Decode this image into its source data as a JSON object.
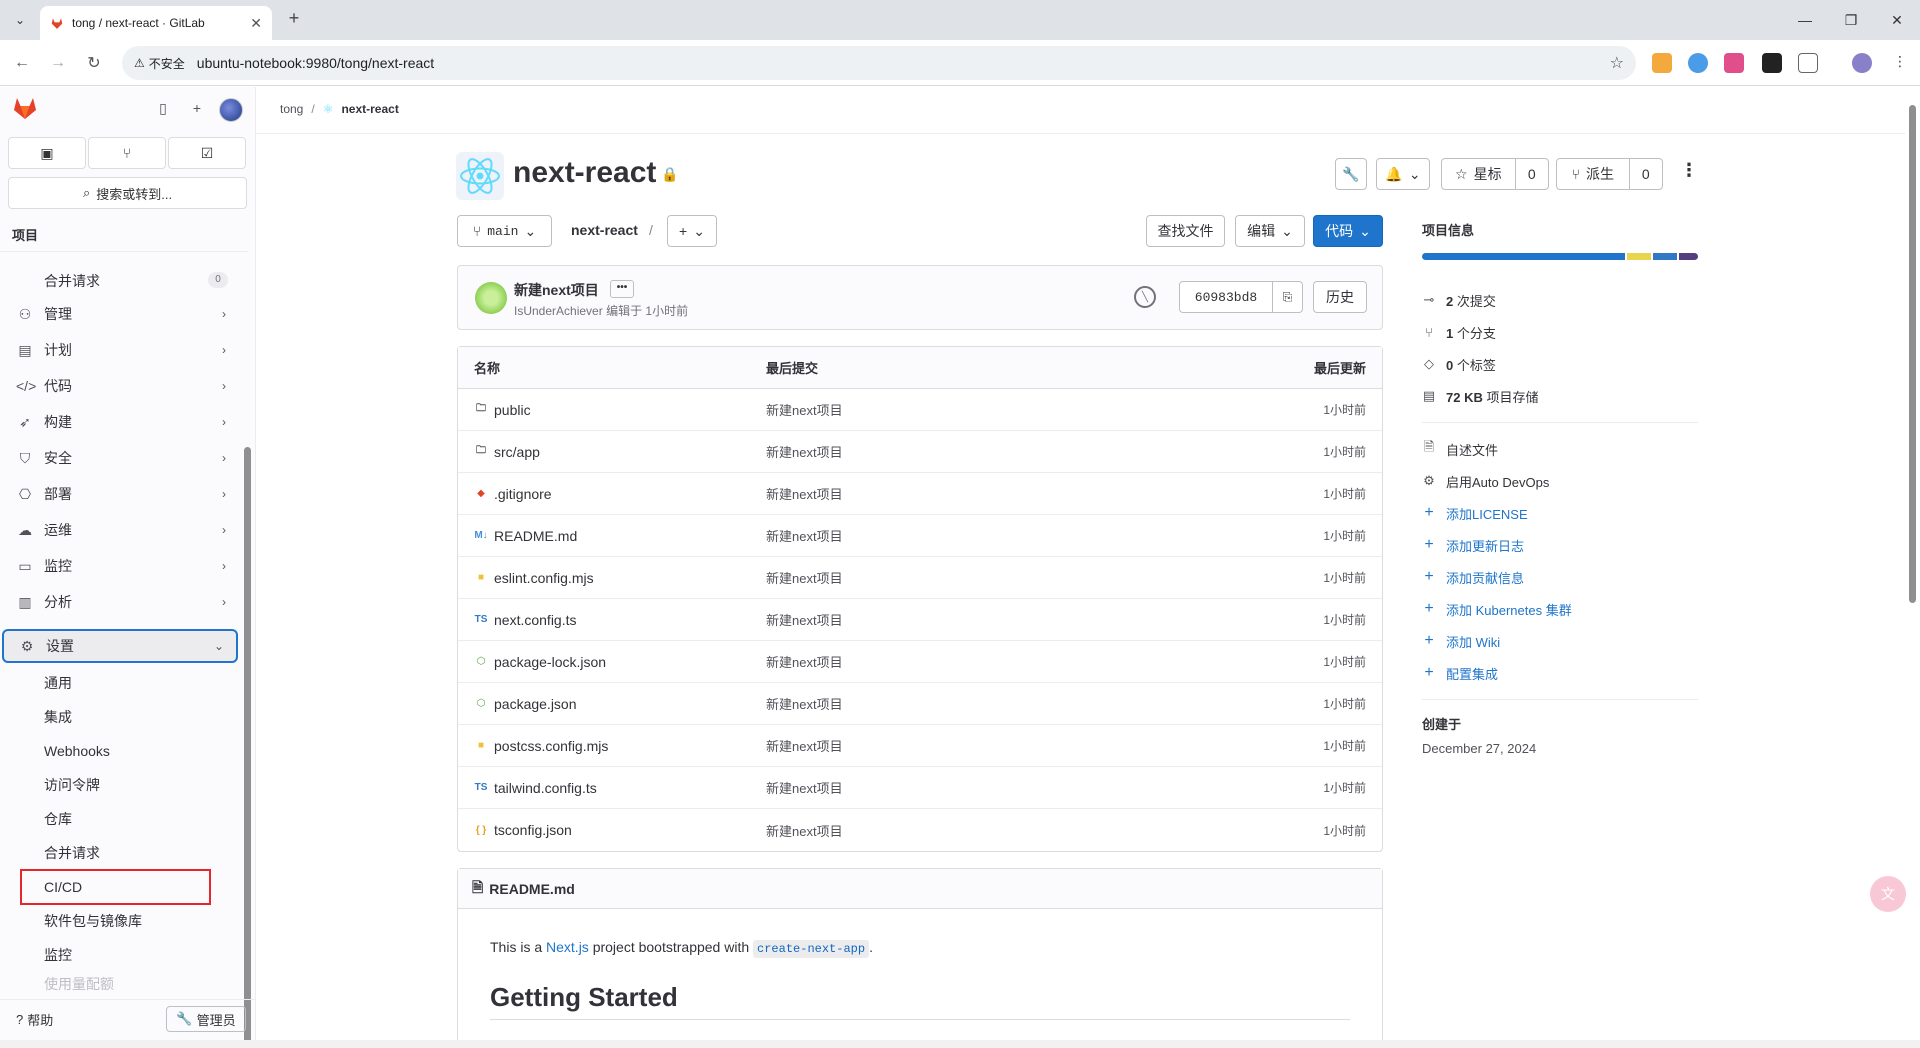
{
  "browser": {
    "tab_title": "tong / next-react · GitLab",
    "new_tab": "+",
    "insecure_label": "不安全",
    "url": "ubuntu-notebook:9980/tong/next-react"
  },
  "sidebar": {
    "search_label": "搜索或转到...",
    "section_label": "项目",
    "merge_requests": "合并请求",
    "merge_requests_count": "0",
    "nav": [
      {
        "label": "管理",
        "icon": "users-icon"
      },
      {
        "label": "计划",
        "icon": "calendar-icon"
      },
      {
        "label": "代码",
        "icon": "code-icon"
      },
      {
        "label": "构建",
        "icon": "rocket-icon"
      },
      {
        "label": "安全",
        "icon": "shield-icon"
      },
      {
        "label": "部署",
        "icon": "deploy-icon"
      },
      {
        "label": "运维",
        "icon": "cloud-icon"
      },
      {
        "label": "监控",
        "icon": "monitor-icon"
      },
      {
        "label": "分析",
        "icon": "chart-icon"
      },
      {
        "label": "设置",
        "icon": "gear-icon"
      }
    ],
    "settings_sub": [
      "通用",
      "集成",
      "Webhooks",
      "访问令牌",
      "仓库",
      "合并请求",
      "CI/CD",
      "软件包与镜像库",
      "监控",
      "使用量配额"
    ],
    "help": "帮助",
    "admin": "管理员"
  },
  "breadcrumb": {
    "owner": "tong",
    "sep": "/",
    "project": "next-react"
  },
  "project": {
    "name": "next-react",
    "star_label": "星标",
    "star_count": "0",
    "fork_label": "派生",
    "fork_count": "0",
    "branch": "main",
    "path": "next-react",
    "path_sep": "/",
    "find_file": "查找文件",
    "edit": "编辑",
    "code": "代码"
  },
  "commit": {
    "title": "新建next项目",
    "more": "•••",
    "author": "IsUnderAchiever",
    "meta": "编辑于 1小时前",
    "sha": "60983bd8",
    "history": "历史"
  },
  "files": {
    "headers": {
      "name": "名称",
      "commit": "最后提交",
      "updated": "最后更新"
    },
    "rows": [
      {
        "name": "public",
        "icon": "folder-icon",
        "commit": "新建next项目",
        "time": "1小时前"
      },
      {
        "name": "src/app",
        "icon": "folder-icon",
        "commit": "新建next项目",
        "time": "1小时前"
      },
      {
        "name": ".gitignore",
        "icon": "git-icon",
        "commit": "新建next项目",
        "time": "1小时前"
      },
      {
        "name": "README.md",
        "icon": "markdown-icon",
        "commit": "新建next项目",
        "time": "1小时前"
      },
      {
        "name": "eslint.config.mjs",
        "icon": "js-icon",
        "commit": "新建next项目",
        "time": "1小时前"
      },
      {
        "name": "next.config.ts",
        "icon": "ts-icon",
        "commit": "新建next项目",
        "time": "1小时前"
      },
      {
        "name": "package-lock.json",
        "icon": "node-icon",
        "commit": "新建next项目",
        "time": "1小时前"
      },
      {
        "name": "package.json",
        "icon": "node-icon",
        "commit": "新建next项目",
        "time": "1小时前"
      },
      {
        "name": "postcss.config.mjs",
        "icon": "js-icon",
        "commit": "新建next项目",
        "time": "1小时前"
      },
      {
        "name": "tailwind.config.ts",
        "icon": "ts-icon",
        "commit": "新建next项目",
        "time": "1小时前"
      },
      {
        "name": "tsconfig.json",
        "icon": "json-icon",
        "commit": "新建next项目",
        "time": "1小时前"
      }
    ]
  },
  "readme": {
    "filename": "README.md",
    "p_prefix": "This is a ",
    "p_link": "Next.js",
    "p_mid": " project bootstrapped with ",
    "p_code": "create-next-app",
    "p_suffix": ".",
    "h2": "Getting Started"
  },
  "info": {
    "title": "项目信息",
    "lang_colors": [
      "#1f75cb",
      "#e8d44d",
      "#3178c6",
      "#563d7c"
    ],
    "lang_shares": [
      0.75,
      0.09,
      0.09,
      0.07
    ],
    "commits_count": "2",
    "commits_label": "次提交",
    "branches_count": "1",
    "branches_label": "个分支",
    "tags_count": "0",
    "tags_label": "个标签",
    "storage_value": "72 KB",
    "storage_label": "项目存储",
    "readme": "自述文件",
    "autodevops": "启用Auto DevOps",
    "links": [
      "添加LICENSE",
      "添加更新日志",
      "添加贡献信息",
      "添加 Kubernetes 集群",
      "添加 Wiki",
      "配置集成"
    ],
    "created_label": "创建于",
    "created_date": "December 27, 2024"
  }
}
